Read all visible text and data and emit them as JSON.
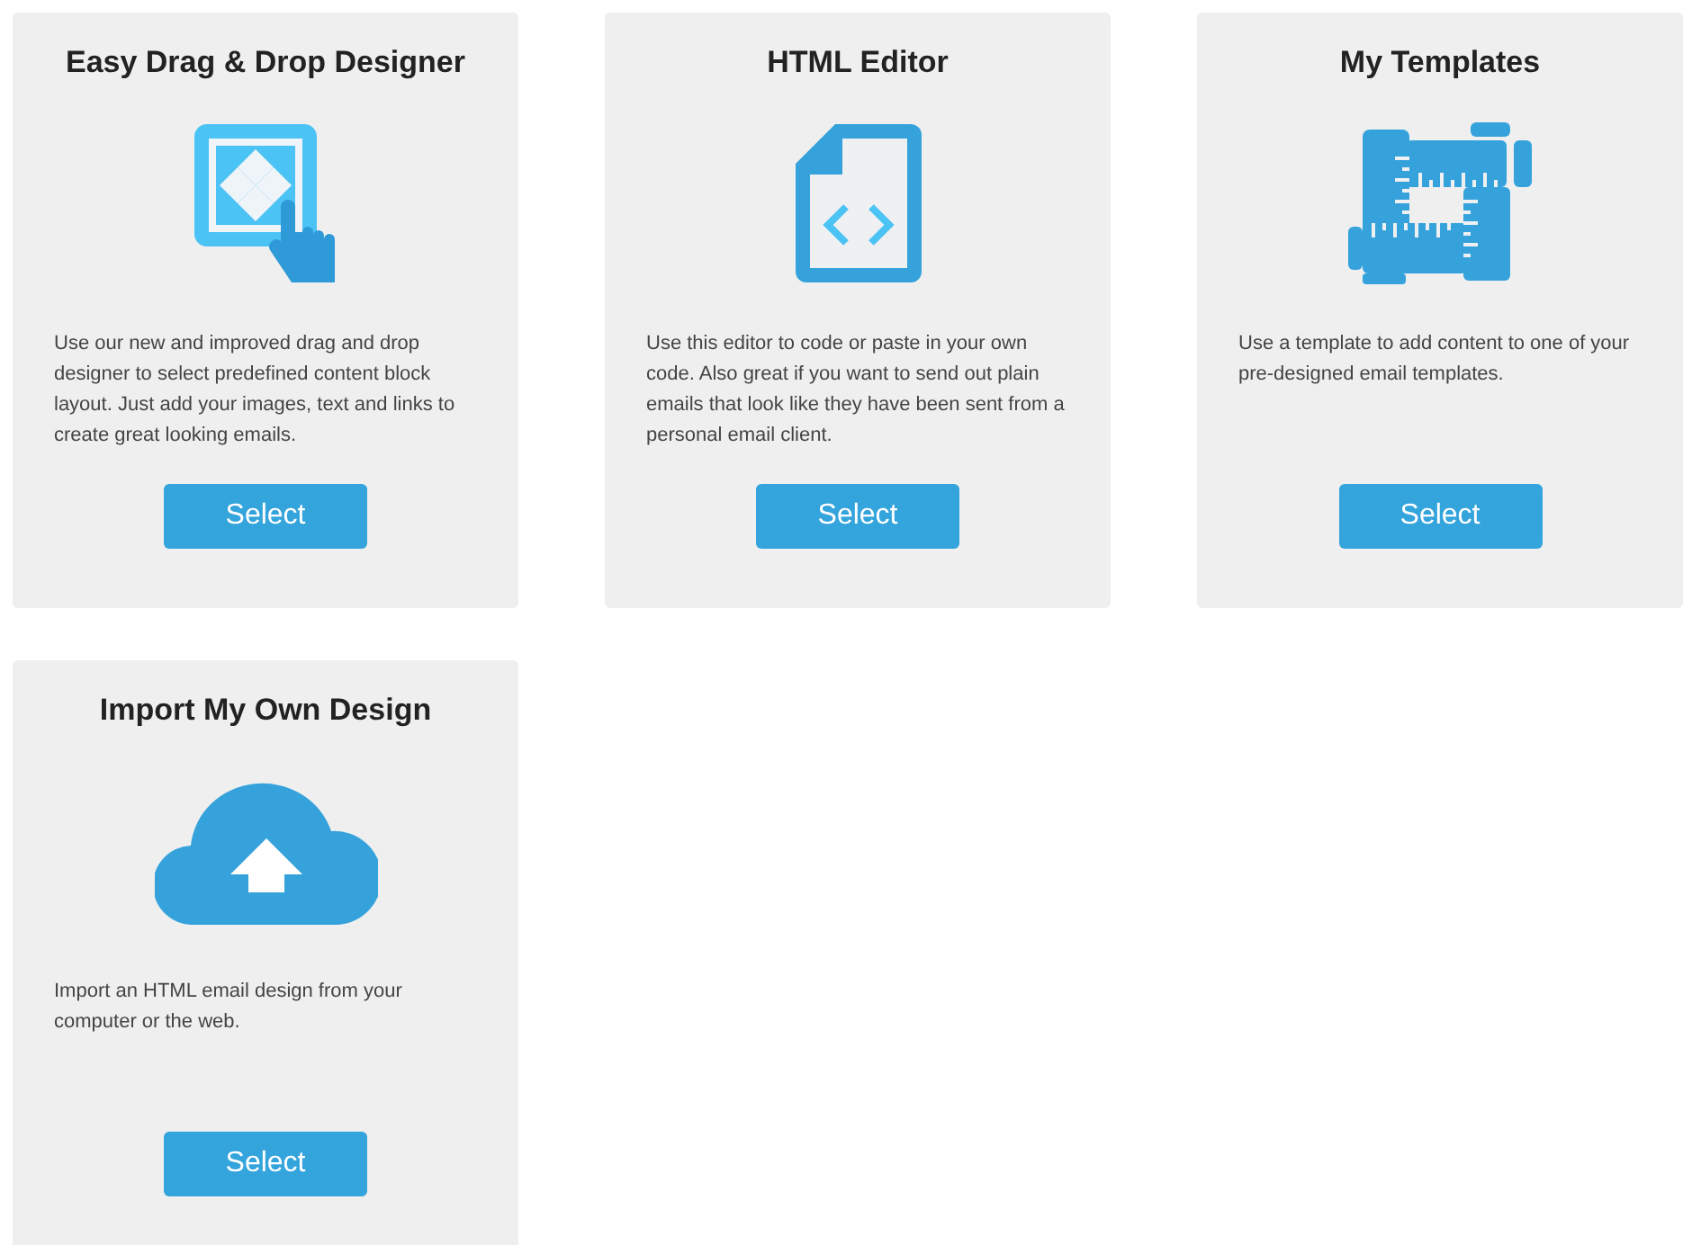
{
  "cards": [
    {
      "title": "Easy Drag & Drop Designer",
      "kind": "drag_drop",
      "description": "Use our new and improved drag and drop designer to select predefined content block layout. Just add your images, text and links to create great looking emails.",
      "button": "Select"
    },
    {
      "title": "HTML Editor",
      "kind": "html",
      "description": "Use this editor to code or paste in your own code. Also great if you want to send out plain emails that look like they have been sent from a personal email client.",
      "button": "Select"
    },
    {
      "title": "My Templates",
      "kind": "templates",
      "description": "Use a template to add content to one of your pre-designed email templates.",
      "button": "Select"
    },
    {
      "title": "Import My Own Design",
      "kind": "upload",
      "description": "Import an HTML email design from your computer or the web.",
      "button": "Select"
    }
  ]
}
